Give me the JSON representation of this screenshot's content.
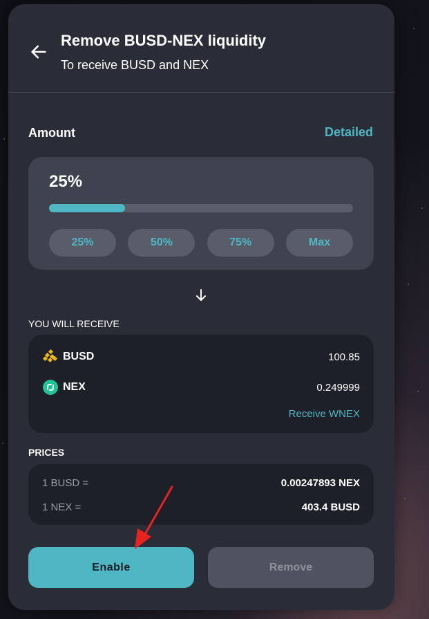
{
  "header": {
    "back_icon": "arrow-left-icon",
    "title": "Remove BUSD-NEX liquidity",
    "subtitle": "To receive BUSD and NEX"
  },
  "amount": {
    "label": "Amount",
    "detailed_link": "Detailed",
    "percent_text": "25%",
    "slider_percent": 25,
    "preset_buttons": [
      "25%",
      "50%",
      "75%",
      "Max"
    ]
  },
  "receive": {
    "label": "YOU WILL RECEIVE",
    "tokens": [
      {
        "symbol": "BUSD",
        "amount": "100.85",
        "icon": "busd-icon"
      },
      {
        "symbol": "NEX",
        "amount": "0.249999",
        "icon": "nex-icon"
      }
    ],
    "receive_wnex_link": "Receive WNEX"
  },
  "prices": {
    "label": "PRICES",
    "rows": [
      {
        "key": "1 BUSD =",
        "value": "0.00247893 NEX"
      },
      {
        "key": "1 NEX =",
        "value": "403.4 BUSD"
      }
    ]
  },
  "actions": {
    "enable_label": "Enable",
    "remove_label": "Remove"
  },
  "colors": {
    "accent": "#4fb7c4",
    "card_bg": "#2a2d38",
    "annotation_arrow": "#e8231f"
  }
}
